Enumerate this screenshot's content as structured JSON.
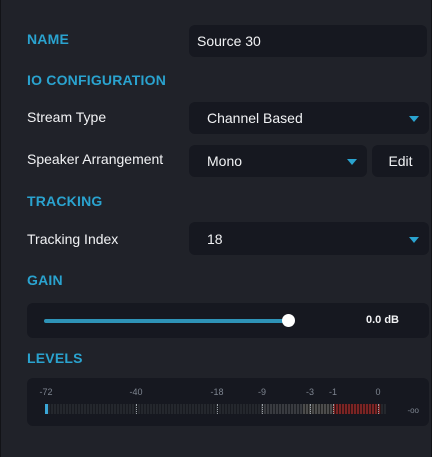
{
  "name_section": {
    "label": "NAME",
    "value": "Source 30"
  },
  "io": {
    "label": "IO CONFIGURATION",
    "stream_type_label": "Stream Type",
    "stream_type_value": "Channel Based",
    "speaker_label": "Speaker Arrangement",
    "speaker_value": "Mono",
    "edit_label": "Edit"
  },
  "tracking": {
    "label": "TRACKING",
    "index_label": "Tracking Index",
    "index_value": "18"
  },
  "gain": {
    "label": "GAIN",
    "value": "0.0 dB",
    "slider_fraction": 0.63
  },
  "levels": {
    "label": "LEVELS",
    "ticks": [
      "-72",
      "-40",
      "-18",
      "-9",
      "-3",
      "-1",
      "0"
    ],
    "floor_label": "-oo",
    "current_level_db": -72
  },
  "colors": {
    "accent": "#2aa3cf",
    "background": "#202229",
    "field": "#161820",
    "clip_zone": "#7b2424"
  }
}
